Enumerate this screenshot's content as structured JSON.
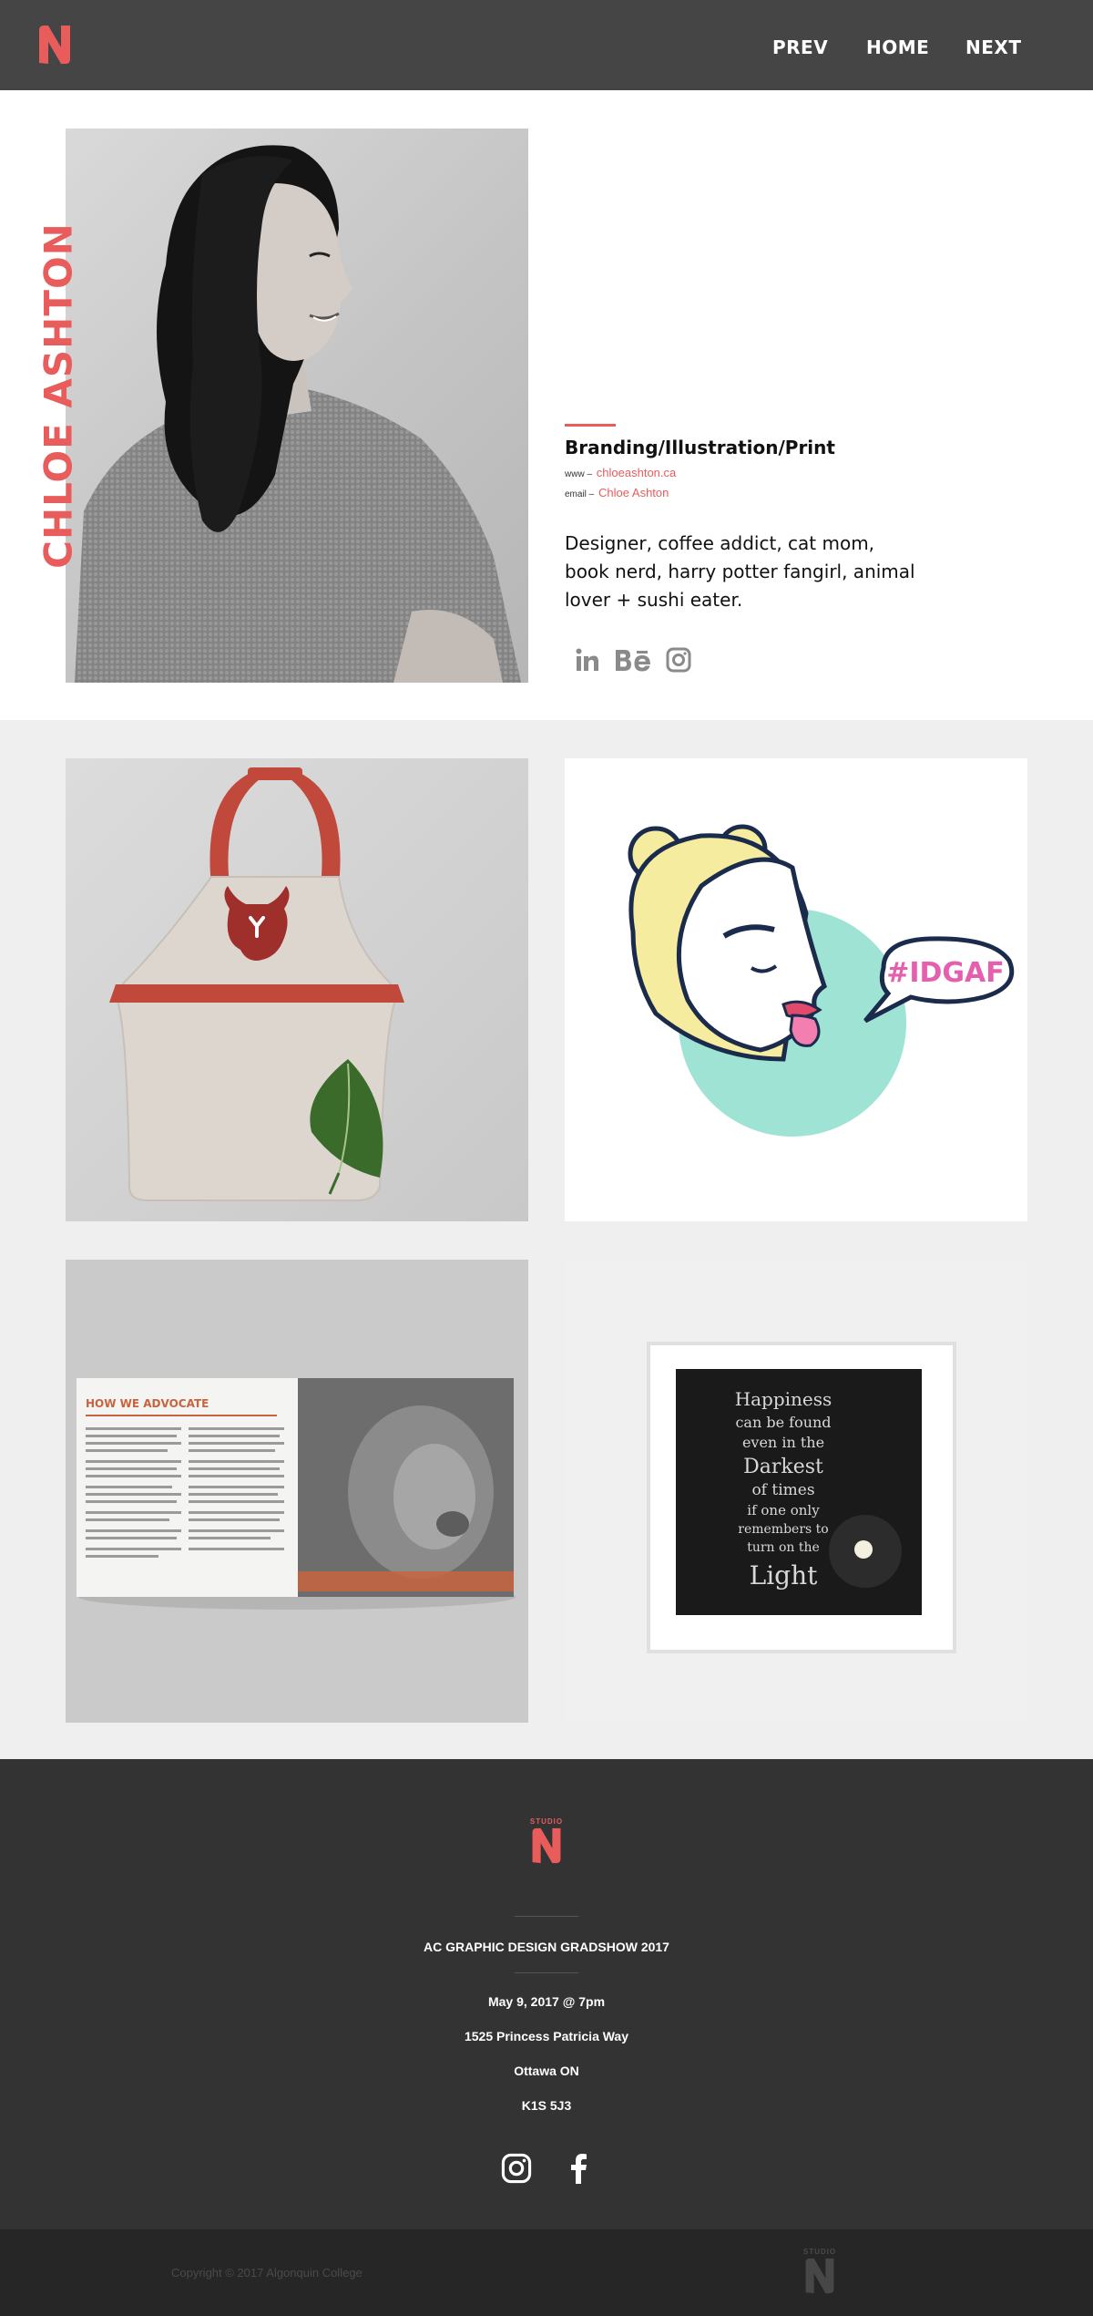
{
  "header": {
    "brand_icon": "studio-n-logo",
    "nav": [
      {
        "label": "PREV"
      },
      {
        "label": "HOME"
      },
      {
        "label": "NEXT"
      }
    ]
  },
  "profile": {
    "name": "CHLOE ASHTON",
    "discipline": "Branding/Illustration/Print",
    "www_label": "www –",
    "www_value": "chloeashton.ca",
    "email_label": "email –",
    "email_value": "Chloe Ashton",
    "bio": "Designer, coffee addict, cat mom, book nerd, harry potter fangirl, animal lover + sushi eater.",
    "social_icons": [
      "linkedin-icon",
      "behance-icon",
      "instagram-icon"
    ]
  },
  "gallery": {
    "items": [
      {
        "icon": "apron-mockup-image"
      },
      {
        "icon": "idgaf-illustration-image",
        "text": "#IDGAF"
      },
      {
        "icon": "brochure-mockup-image",
        "text": "HOW WE ADVOCATE"
      },
      {
        "icon": "framed-print-image",
        "text_lines": [
          "Happiness",
          "can be found",
          "even in the",
          "Darkest",
          "of times",
          "if one only",
          "remembers to",
          "turn on the",
          "Light"
        ]
      }
    ]
  },
  "footer": {
    "logo_small": "STUDIO",
    "event": "AC GRAPHIC DESIGN GRADSHOW 2017",
    "date": "May 9, 2017 @ 7pm",
    "street": "1525 Princess Patricia Way",
    "city": "Ottawa ON",
    "postal": "K1S 5J3",
    "social_icons": [
      "instagram-icon",
      "facebook-icon"
    ],
    "copyright": "Copyright © 2017 Algonquin College",
    "sub_logo_small": "STUDIO"
  },
  "colors": {
    "accent": "#e85c5c",
    "header_bg": "#454545",
    "footer_bg": "#333333",
    "subfooter_bg": "#262626",
    "gallery_bg": "#efeff0"
  }
}
